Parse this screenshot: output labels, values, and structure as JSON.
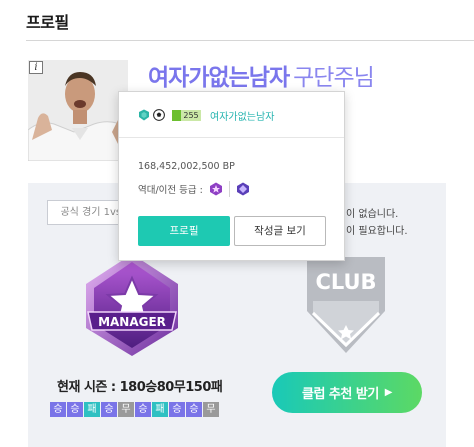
{
  "header": {
    "title": "프로필"
  },
  "profile": {
    "nickname": "여자가없는남자",
    "role": "구단주님",
    "info_badge": "i"
  },
  "tabs": {
    "official_match": "공식 경기 1vs1"
  },
  "side_notice": {
    "line1": "이 없습니다.",
    "line2": "이 필요합니다."
  },
  "manager_emblem": {
    "label": "MANAGER"
  },
  "club_emblem": {
    "label": "CLUB"
  },
  "season": {
    "record_text": "현재 시즌 : 180승80무150패",
    "recent_results": [
      "승",
      "승",
      "패",
      "승",
      "무",
      "승",
      "패",
      "승",
      "승",
      "무"
    ]
  },
  "recommend_button": {
    "label": "클럽 추천 받기",
    "arrow": "▶"
  },
  "popup": {
    "level": "255",
    "nickname": "여자가없는남자",
    "bp": "168,452,002,500 BP",
    "grade_label": "역대/이전 등급 :",
    "profile_button": "프로필",
    "posts_button": "작성글 보기",
    "icons": [
      "team-emblem-icon",
      "soccer-ball-icon",
      "level-bar"
    ]
  },
  "colors": {
    "accent_purple": "#7a76ec",
    "teal": "#1ec9b2",
    "win": "#7a74e8",
    "draw": "#9a9a9a",
    "loss": "#2fc0c2",
    "panel_bg": "#eff1f5"
  }
}
